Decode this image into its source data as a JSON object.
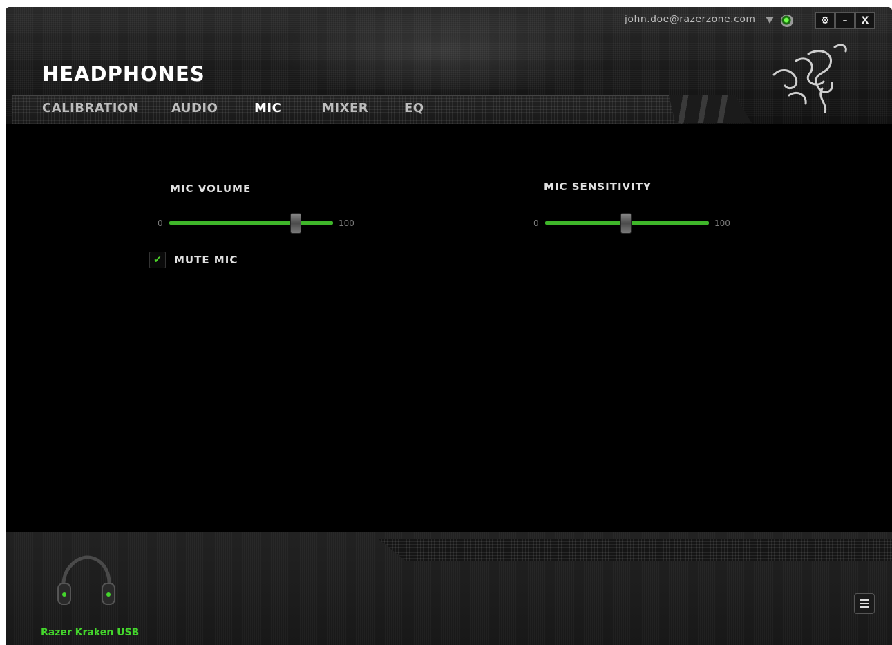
{
  "window": {
    "title": "HEADPHONES"
  },
  "account": {
    "email": "john.doe@razerzone.com"
  },
  "window_controls": {
    "settings_icon": "gear-icon",
    "minimize_label": "–",
    "close_label": "X"
  },
  "tabs": [
    {
      "label": "CALIBRATION",
      "active": false
    },
    {
      "label": "AUDIO",
      "active": false
    },
    {
      "label": "MIC",
      "active": true
    },
    {
      "label": "MIXER",
      "active": false
    },
    {
      "label": "EQ",
      "active": false
    }
  ],
  "mic_volume": {
    "label": "MIC VOLUME",
    "min": "0",
    "max": "100",
    "value_fraction": 0.77
  },
  "mic_sensitivity": {
    "label": "MIC SENSITIVITY",
    "min": "0",
    "max": "100",
    "value_fraction": 0.49
  },
  "mute_mic": {
    "label": "MUTE MIC",
    "checked": true
  },
  "device": {
    "name": "Razer Kraken USB"
  },
  "colors": {
    "accent": "#44d62c",
    "background": "#000000"
  }
}
